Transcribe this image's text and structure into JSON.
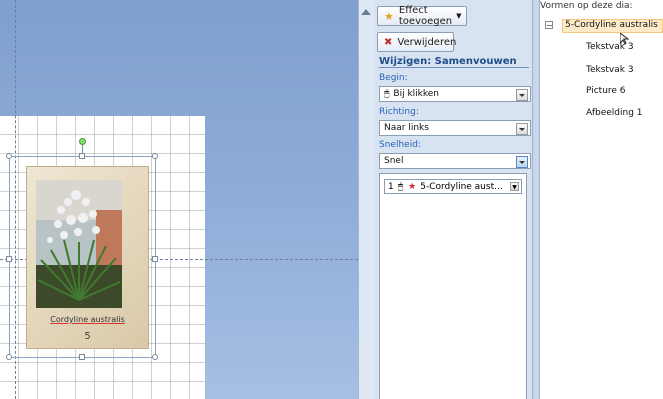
{
  "animation_pane": {
    "add_effect_label": "Effect toevoegen",
    "remove_label": "Verwijderen",
    "section_title": "Wijzigen: Samenvouwen",
    "start_label": "Begin:",
    "start_value": "Bij klikken",
    "direction_label": "Richting:",
    "direction_value": "Naar links",
    "speed_label": "Snelheid:",
    "speed_value": "Snel",
    "list_item": {
      "index": "1",
      "label": "5-Cordyline aust..."
    }
  },
  "selection_pane": {
    "header": "Vormen op deze dia:",
    "group_label": "5-Cordyline australis",
    "children": [
      "Tekstvak 3",
      "Tekstvak 3",
      "Picture 6",
      "Afbeelding 1"
    ]
  },
  "slide": {
    "caption": "Cordyline australis",
    "number": "5"
  },
  "colors": {
    "canvas": "#8dabd7",
    "pane": "#d8e3f2",
    "accent": "#1f4e8a"
  }
}
